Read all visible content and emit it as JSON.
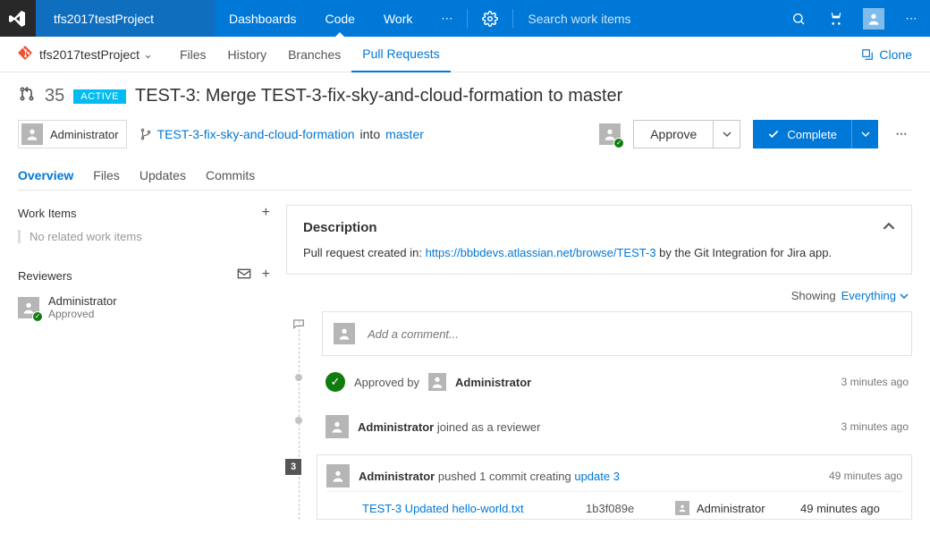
{
  "topbar": {
    "project": "tfs2017testProject",
    "tabs": [
      "Dashboards",
      "Code",
      "Work"
    ],
    "active_tab": "Code",
    "search_placeholder": "Search work items"
  },
  "subnav": {
    "breadcrumb": "tfs2017testProject",
    "items": [
      "Files",
      "History",
      "Branches",
      "Pull Requests"
    ],
    "active": "Pull Requests",
    "clone": "Clone"
  },
  "pr": {
    "id": "35",
    "status": "ACTIVE",
    "title": "TEST-3: Merge TEST-3-fix-sky-and-cloud-formation to master",
    "creator": "Administrator",
    "source_branch": "TEST-3-fix-sky-and-cloud-formation",
    "into": "into",
    "target_branch": "master",
    "approve": "Approve",
    "complete": "Complete"
  },
  "prtabs": [
    "Overview",
    "Files",
    "Updates",
    "Commits"
  ],
  "side": {
    "work_items_title": "Work Items",
    "work_items_empty": "No related work items",
    "reviewers_title": "Reviewers",
    "reviewer": {
      "name": "Administrator",
      "status": "Approved"
    }
  },
  "description": {
    "title": "Description",
    "prefix": "Pull request created in: ",
    "link": "https://bbbdevs.atlassian.net/browse/TEST-3",
    "suffix": " by the Git Integration for Jira app."
  },
  "filter": {
    "label": "Showing",
    "value": "Everything"
  },
  "comment_placeholder": "Add a comment...",
  "events": {
    "approved": {
      "prefix": "Approved by",
      "user": "Administrator",
      "time": "3 minutes ago"
    },
    "joined": {
      "user": "Administrator",
      "text": "joined as a reviewer",
      "time": "3 minutes ago"
    },
    "pushed": {
      "badge": "3",
      "user": "Administrator",
      "text": "pushed 1 commit creating",
      "link": "update 3",
      "time": "49 minutes ago"
    },
    "commit": {
      "msg": "TEST-3 Updated hello-world.txt",
      "hash": "1b3f089e",
      "user": "Administrator",
      "time": "49 minutes ago"
    }
  }
}
